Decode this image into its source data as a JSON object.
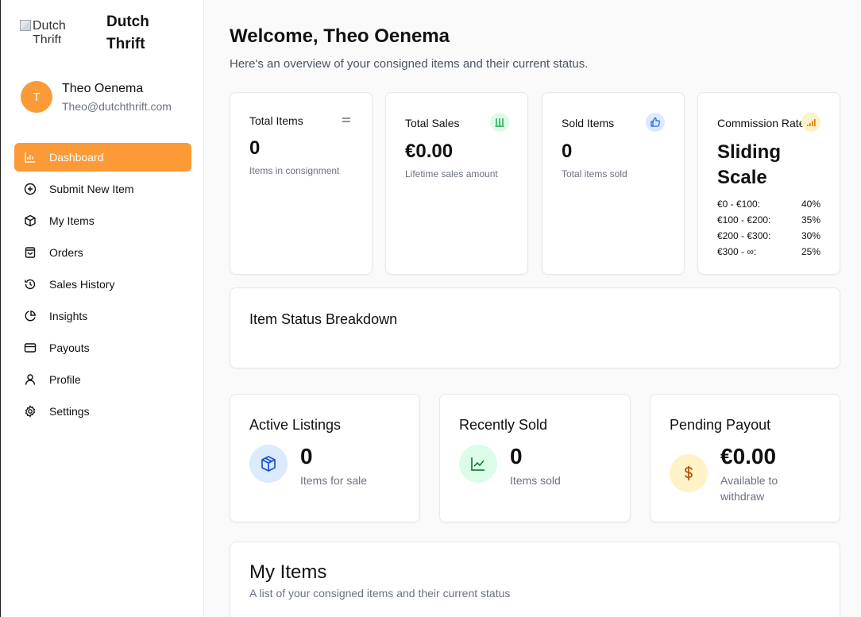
{
  "brand": {
    "logo_alt": "Dutch Thrift",
    "name": "Dutch Thrift"
  },
  "user": {
    "initial": "T",
    "name": "Theo Oenema",
    "email": "Theo@dutchthrift.com"
  },
  "nav": {
    "items": [
      {
        "label": "Dashboard",
        "icon": "bar-chart-icon",
        "active": true
      },
      {
        "label": "Submit New Item",
        "icon": "plus-circle-icon"
      },
      {
        "label": "My Items",
        "icon": "package-icon"
      },
      {
        "label": "Orders",
        "icon": "shopping-bag-icon"
      },
      {
        "label": "Sales History",
        "icon": "history-icon"
      },
      {
        "label": "Insights",
        "icon": "pie-chart-icon"
      },
      {
        "label": "Payouts",
        "icon": "credit-card-icon"
      },
      {
        "label": "Profile",
        "icon": "user-icon"
      },
      {
        "label": "Settings",
        "icon": "gear-icon"
      }
    ]
  },
  "header": {
    "title": "Welcome, Theo Oenema",
    "subtitle": "Here's an overview of your consigned items and their current status."
  },
  "stats": {
    "total_items": {
      "label": "Total Items",
      "value": "0",
      "sub": "Items in consignment",
      "icon": "equals-icon"
    },
    "total_sales": {
      "label": "Total Sales",
      "value": "€0.00",
      "sub": "Lifetime sales amount",
      "icon": "bars-icon",
      "color": "#16a34a"
    },
    "sold_items": {
      "label": "Sold Items",
      "value": "0",
      "sub": "Total items sold",
      "icon": "thumbs-up-icon",
      "color": "#2563eb"
    },
    "commission": {
      "label": "Commission Rate",
      "value": "Sliding Scale",
      "icon": "signal-icon",
      "color": "#d97706",
      "tiers": [
        {
          "range": "€0 - €100:",
          "rate": "40%"
        },
        {
          "range": "€100 - €200:",
          "rate": "35%"
        },
        {
          "range": "€200 - €300:",
          "rate": "30%"
        },
        {
          "range": "€300 - ∞:",
          "rate": "25%"
        }
      ]
    }
  },
  "breakdown": {
    "title": "Item Status Breakdown"
  },
  "summary": {
    "active": {
      "title": "Active Listings",
      "value": "0",
      "sub": "Items for sale",
      "icon": "package-icon",
      "color": "#1d4ed8"
    },
    "sold": {
      "title": "Recently Sold",
      "value": "0",
      "sub": "Items sold",
      "icon": "trend-chart-icon",
      "color": "#15803d"
    },
    "payout": {
      "title": "Pending Payout",
      "value": "€0.00",
      "sub": "Available to withdraw",
      "icon": "dollar-icon",
      "color": "#b45309"
    }
  },
  "my_items": {
    "title": "My Items",
    "subtitle": "A list of your consigned items and their current status"
  }
}
